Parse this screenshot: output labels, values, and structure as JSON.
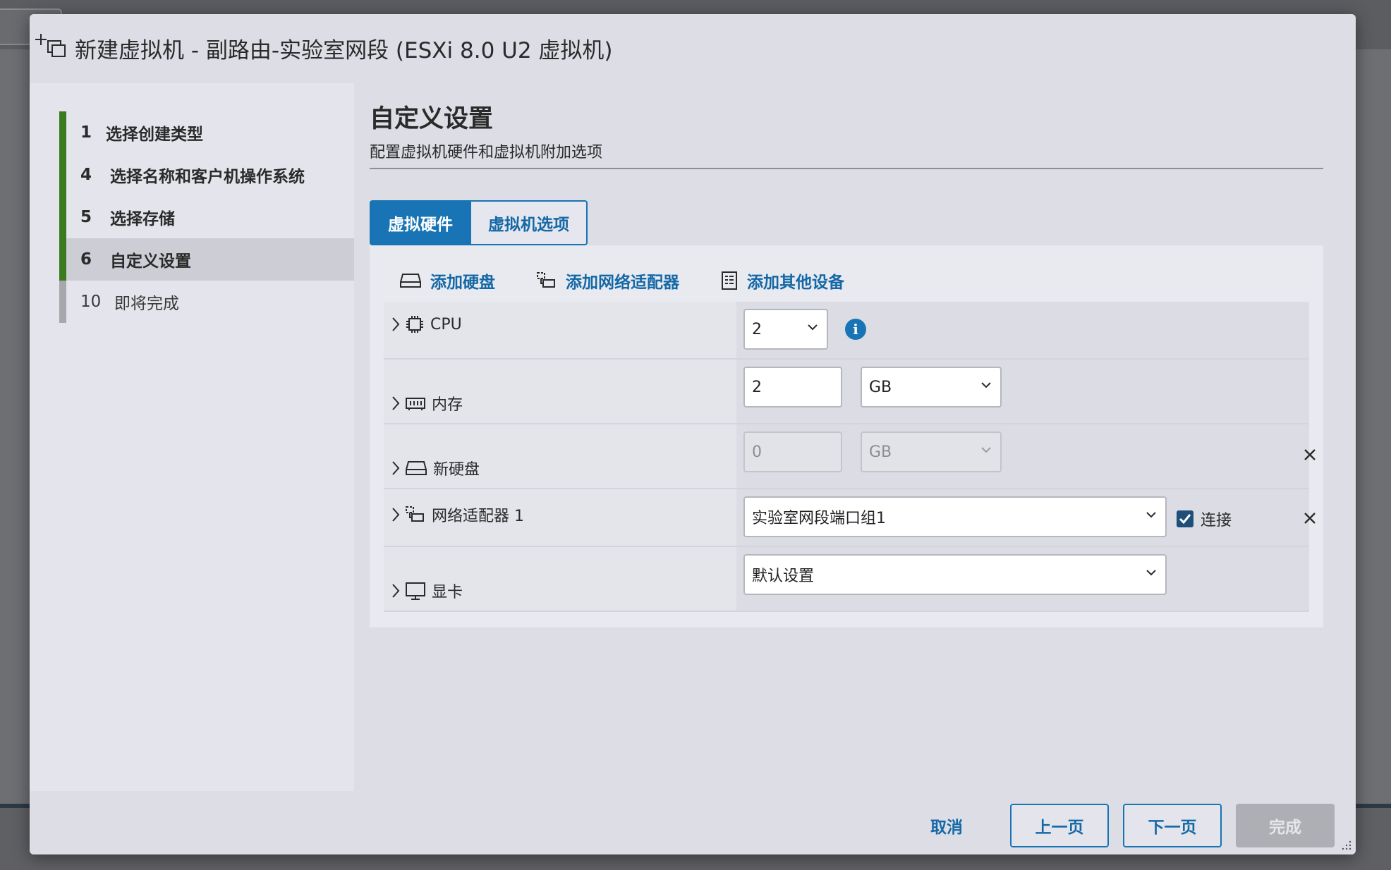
{
  "dialog": {
    "title": "新建虚拟机 - 副路由-实验室网段 (ESXi 8.0 U2 虚拟机)"
  },
  "steps": [
    {
      "num": "1",
      "label": "选择创建类型",
      "state": "done"
    },
    {
      "num": "4",
      "label": "选择名称和客户机操作系统",
      "state": "done"
    },
    {
      "num": "5",
      "label": "选择存储",
      "state": "done"
    },
    {
      "num": "6",
      "label": "自定义设置",
      "state": "active"
    },
    {
      "num": "10",
      "label": "即将完成",
      "state": "pending"
    }
  ],
  "main": {
    "title": "自定义设置",
    "subtitle": "配置虚拟机硬件和虚拟机附加选项",
    "tabs": [
      {
        "label": "虚拟硬件",
        "active": true
      },
      {
        "label": "虚拟机选项",
        "active": false
      }
    ],
    "toolbar": {
      "add_disk": "添加硬盘",
      "add_network": "添加网络适配器",
      "add_other": "添加其他设备"
    },
    "hardware": {
      "cpu": {
        "label": "CPU",
        "value": "2"
      },
      "memory": {
        "label": "内存",
        "value": "2",
        "unit": "GB"
      },
      "new_disk": {
        "label": "新硬盘",
        "value": "0",
        "unit": "GB"
      },
      "network": {
        "label": "网络适配器 1",
        "value": "实验室网段端口组1",
        "connect_label": "连接",
        "connected": true
      },
      "video": {
        "label": "显卡",
        "value": "默认设置"
      }
    }
  },
  "footer": {
    "cancel": "取消",
    "back": "上一页",
    "next": "下一页",
    "finish": "完成"
  },
  "colors": {
    "accent": "#1874b4",
    "step_done": "#3b7a1e",
    "step_pending": "#a7a8ac"
  }
}
